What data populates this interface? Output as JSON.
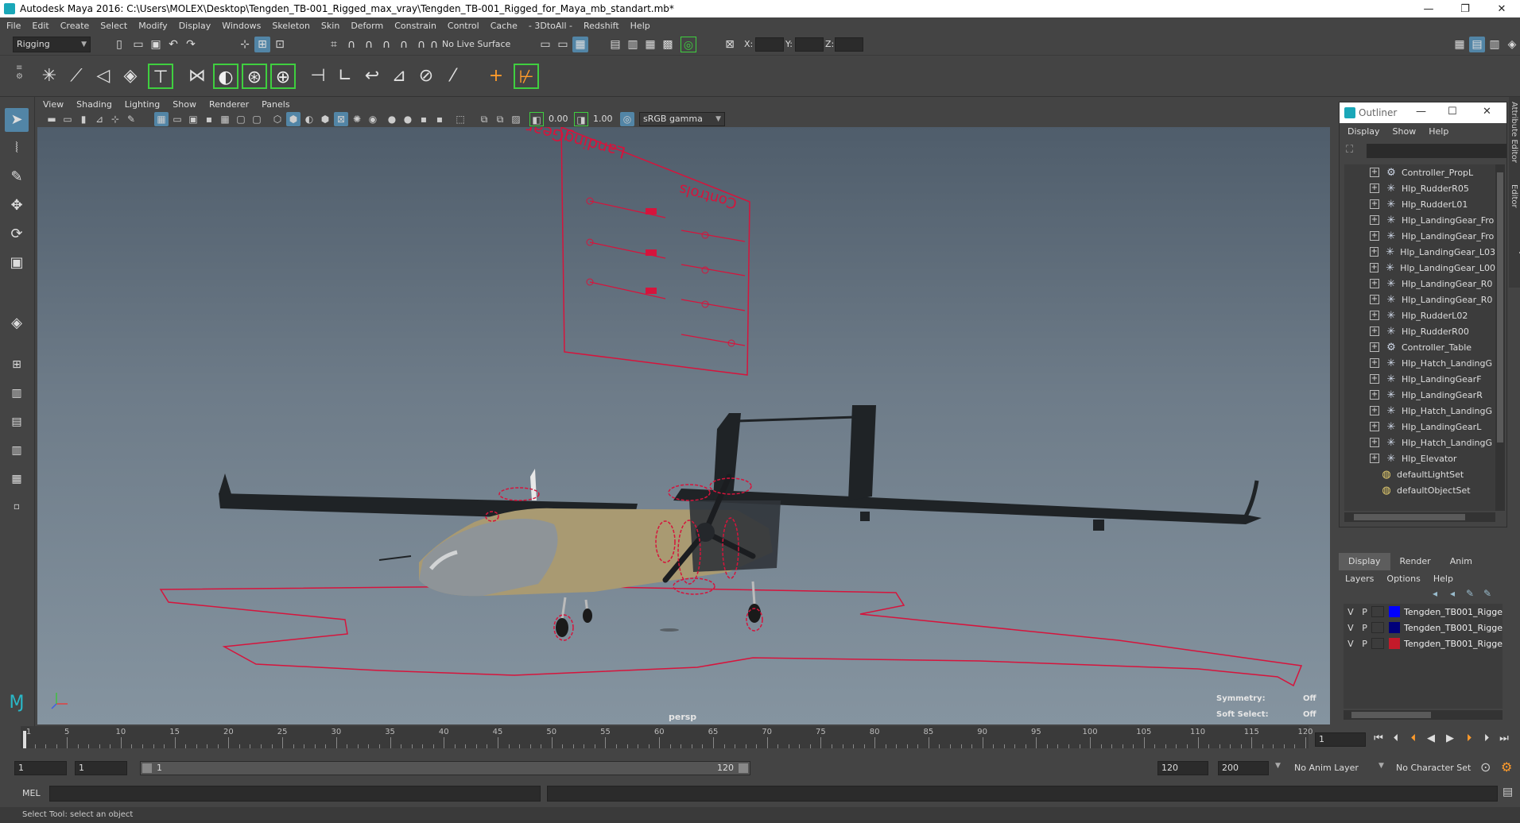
{
  "window": {
    "title": "Autodesk Maya 2016: C:\\Users\\MOLEX\\Desktop\\Tengden_TB-001_Rigged_max_vray\\Tengden_TB-001_Rigged_for_Maya_mb_standart.mb*",
    "minimize": "—",
    "restore": "❐",
    "close": "✕"
  },
  "menubar": [
    "File",
    "Edit",
    "Create",
    "Select",
    "Modify",
    "Display",
    "Windows",
    "Skeleton",
    "Skin",
    "Deform",
    "Constrain",
    "Control",
    "Cache",
    "- 3DtoAll -",
    "Redshift",
    "Help"
  ],
  "statusline": {
    "menuset": "Rigging",
    "live_surface": "No Live Surface",
    "x_label": "X:",
    "y_label": "Y:",
    "z_label": "Z:"
  },
  "panel_menu": [
    "View",
    "Shading",
    "Lighting",
    "Show",
    "Renderer",
    "Panels"
  ],
  "panel_toolbar": {
    "exposure": "0.00",
    "gamma": "1.00",
    "color_space": "sRGB gamma"
  },
  "viewport": {
    "camera": "persp",
    "symmetry_label": "Symmetry:",
    "symmetry_value": "Off",
    "soft_select_label": "Soft Select:",
    "soft_select_value": "Off",
    "control_board_title": "LandingGear",
    "control_board_title2": "Controls"
  },
  "outliner": {
    "title": "Outliner",
    "menu": [
      "Display",
      "Show",
      "Help"
    ],
    "items": [
      {
        "name": "Controller_PropL",
        "kind": "group"
      },
      {
        "name": "Hlp_RudderR05",
        "kind": "helper"
      },
      {
        "name": "Hlp_RudderL01",
        "kind": "helper"
      },
      {
        "name": "Hlp_LandingGear_Fro",
        "kind": "helper"
      },
      {
        "name": "Hlp_LandingGear_Fro",
        "kind": "helper"
      },
      {
        "name": "Hlp_LandingGear_L03",
        "kind": "helper"
      },
      {
        "name": "Hlp_LandingGear_L00",
        "kind": "helper"
      },
      {
        "name": "Hlp_LandingGear_R0",
        "kind": "helper"
      },
      {
        "name": "Hlp_LandingGear_R0",
        "kind": "helper"
      },
      {
        "name": "Hlp_RudderL02",
        "kind": "helper"
      },
      {
        "name": "Hlp_RudderR00",
        "kind": "helper"
      },
      {
        "name": "Controller_Table",
        "kind": "group"
      },
      {
        "name": "Hlp_Hatch_LandingG",
        "kind": "helper"
      },
      {
        "name": "Hlp_LandingGearF",
        "kind": "helper"
      },
      {
        "name": "Hlp_LandingGearR",
        "kind": "helper"
      },
      {
        "name": "Hlp_Hatch_LandingG",
        "kind": "helper"
      },
      {
        "name": "Hlp_LandingGearL",
        "kind": "helper"
      },
      {
        "name": "Hlp_Hatch_LandingG",
        "kind": "helper"
      },
      {
        "name": "Hlp_Elevator",
        "kind": "helper"
      },
      {
        "name": "defaultLightSet",
        "kind": "set"
      },
      {
        "name": "defaultObjectSet",
        "kind": "set"
      }
    ]
  },
  "side_tabs": [
    "Attribute Editor",
    "Channel Box / Layer Editor"
  ],
  "layer_editor": {
    "tabs": [
      "Display",
      "Render",
      "Anim"
    ],
    "menu": [
      "Layers",
      "Options",
      "Help"
    ],
    "layers": [
      {
        "v": "V",
        "p": "P",
        "name": "Tengden_TB001_Rigge",
        "color": "#0000ff"
      },
      {
        "v": "V",
        "p": "P",
        "name": "Tengden_TB001_Rigge",
        "color": "#00007a"
      },
      {
        "v": "V",
        "p": "P",
        "name": "Tengden_TB001_Rigge",
        "color": "#c41a2a"
      }
    ]
  },
  "timeline": {
    "ticks": [
      "1",
      "5",
      "10",
      "15",
      "20",
      "25",
      "30",
      "35",
      "40",
      "45",
      "50",
      "55",
      "60",
      "65",
      "70",
      "75",
      "80",
      "85",
      "90",
      "95",
      "100",
      "105",
      "110",
      "115",
      "120"
    ],
    "current_frame": "1"
  },
  "range": {
    "start": "1",
    "playback_start": "1",
    "slider_start": "1",
    "slider_end": "120",
    "playback_end": "120",
    "end": "200",
    "anim_layer": "No Anim Layer",
    "character_set": "No Character Set"
  },
  "cmdline": {
    "language": "MEL"
  },
  "helpline": {
    "text": "Select Tool: select an object"
  }
}
